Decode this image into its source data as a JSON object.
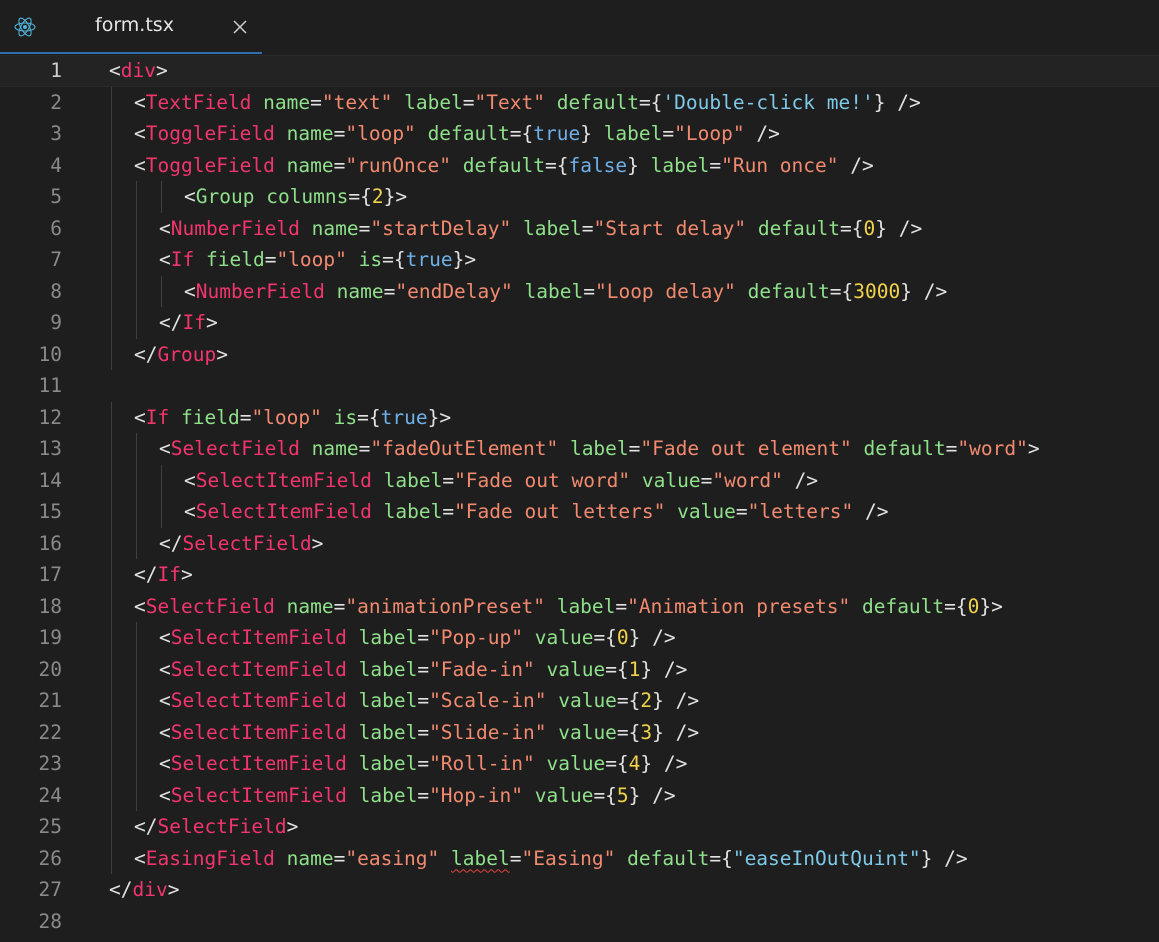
{
  "tab": {
    "icon": "react-icon",
    "title": "form.tsx",
    "close_icon": "close-icon"
  },
  "editor": {
    "current_line": 1,
    "lines": [
      {
        "n": "1",
        "indent": 0,
        "tokens": [
          [
            "p",
            "<"
          ],
          [
            "t",
            "div"
          ],
          [
            "p",
            ">"
          ]
        ]
      },
      {
        "n": "2",
        "indent": 1,
        "tokens": [
          [
            "p",
            "<"
          ],
          [
            "t",
            "TextField"
          ],
          [
            "p",
            " "
          ],
          [
            "a",
            "name"
          ],
          [
            "p",
            "="
          ],
          [
            "s",
            "\"text\""
          ],
          [
            "p",
            " "
          ],
          [
            "a",
            "label"
          ],
          [
            "p",
            "="
          ],
          [
            "s",
            "\"Text\""
          ],
          [
            "p",
            " "
          ],
          [
            "a",
            "default"
          ],
          [
            "p",
            "={"
          ],
          [
            "c",
            "'Double-click me!'"
          ],
          [
            "p",
            "} />"
          ]
        ]
      },
      {
        "n": "3",
        "indent": 1,
        "tokens": [
          [
            "p",
            "<"
          ],
          [
            "t",
            "ToggleField"
          ],
          [
            "p",
            " "
          ],
          [
            "a",
            "name"
          ],
          [
            "p",
            "="
          ],
          [
            "s",
            "\"loop\""
          ],
          [
            "p",
            " "
          ],
          [
            "a",
            "default"
          ],
          [
            "p",
            "={"
          ],
          [
            "k",
            "true"
          ],
          [
            "p",
            "} "
          ],
          [
            "a",
            "label"
          ],
          [
            "p",
            "="
          ],
          [
            "s",
            "\"Loop\""
          ],
          [
            "p",
            " />"
          ]
        ]
      },
      {
        "n": "4",
        "indent": 1,
        "tokens": [
          [
            "p",
            "<"
          ],
          [
            "t",
            "ToggleField"
          ],
          [
            "p",
            " "
          ],
          [
            "a",
            "name"
          ],
          [
            "p",
            "="
          ],
          [
            "s",
            "\"runOnce\""
          ],
          [
            "p",
            " "
          ],
          [
            "a",
            "default"
          ],
          [
            "p",
            "={"
          ],
          [
            "k",
            "false"
          ],
          [
            "p",
            "} "
          ],
          [
            "a",
            "label"
          ],
          [
            "p",
            "="
          ],
          [
            "s",
            "\"Run once\""
          ],
          [
            "p",
            " />"
          ]
        ]
      },
      {
        "n": "5",
        "indent": 3,
        "tokens": [
          [
            "p",
            "<"
          ],
          [
            "a",
            "Group"
          ],
          [
            "p",
            " "
          ],
          [
            "a",
            "columns"
          ],
          [
            "p",
            "={"
          ],
          [
            "n",
            "2"
          ],
          [
            "p",
            "}>"
          ]
        ]
      },
      {
        "n": "6",
        "indent": 2,
        "tokens": [
          [
            "p",
            "<"
          ],
          [
            "t",
            "NumberField"
          ],
          [
            "p",
            " "
          ],
          [
            "a",
            "name"
          ],
          [
            "p",
            "="
          ],
          [
            "s",
            "\"startDelay\""
          ],
          [
            "p",
            " "
          ],
          [
            "a",
            "label"
          ],
          [
            "p",
            "="
          ],
          [
            "s",
            "\"Start delay\""
          ],
          [
            "p",
            " "
          ],
          [
            "a",
            "default"
          ],
          [
            "p",
            "={"
          ],
          [
            "n",
            "0"
          ],
          [
            "p",
            "} />"
          ]
        ]
      },
      {
        "n": "7",
        "indent": 2,
        "tokens": [
          [
            "p",
            "<"
          ],
          [
            "t",
            "If"
          ],
          [
            "p",
            " "
          ],
          [
            "a",
            "field"
          ],
          [
            "p",
            "="
          ],
          [
            "s",
            "\"loop\""
          ],
          [
            "p",
            " "
          ],
          [
            "a",
            "is"
          ],
          [
            "p",
            "={"
          ],
          [
            "k",
            "true"
          ],
          [
            "p",
            "}>"
          ]
        ]
      },
      {
        "n": "8",
        "indent": 3,
        "tokens": [
          [
            "p",
            "<"
          ],
          [
            "t",
            "NumberField"
          ],
          [
            "p",
            " "
          ],
          [
            "a",
            "name"
          ],
          [
            "p",
            "="
          ],
          [
            "s",
            "\"endDelay\""
          ],
          [
            "p",
            " "
          ],
          [
            "a",
            "label"
          ],
          [
            "p",
            "="
          ],
          [
            "s",
            "\"Loop delay\""
          ],
          [
            "p",
            " "
          ],
          [
            "a",
            "default"
          ],
          [
            "p",
            "={"
          ],
          [
            "n",
            "3000"
          ],
          [
            "p",
            "} />"
          ]
        ]
      },
      {
        "n": "9",
        "indent": 2,
        "tokens": [
          [
            "p",
            "</"
          ],
          [
            "t",
            "If"
          ],
          [
            "p",
            ">"
          ]
        ]
      },
      {
        "n": "10",
        "indent": 1,
        "tokens": [
          [
            "p",
            "</"
          ],
          [
            "t",
            "Group"
          ],
          [
            "p",
            ">"
          ]
        ]
      },
      {
        "n": "11",
        "indent": 0,
        "tokens": []
      },
      {
        "n": "12",
        "indent": 1,
        "tokens": [
          [
            "p",
            "<"
          ],
          [
            "t",
            "If"
          ],
          [
            "p",
            " "
          ],
          [
            "a",
            "field"
          ],
          [
            "p",
            "="
          ],
          [
            "s",
            "\"loop\""
          ],
          [
            "p",
            " "
          ],
          [
            "a",
            "is"
          ],
          [
            "p",
            "={"
          ],
          [
            "k",
            "true"
          ],
          [
            "p",
            "}>"
          ]
        ]
      },
      {
        "n": "13",
        "indent": 2,
        "tokens": [
          [
            "p",
            "<"
          ],
          [
            "t",
            "SelectField"
          ],
          [
            "p",
            " "
          ],
          [
            "a",
            "name"
          ],
          [
            "p",
            "="
          ],
          [
            "s",
            "\"fadeOutElement\""
          ],
          [
            "p",
            " "
          ],
          [
            "a",
            "label"
          ],
          [
            "p",
            "="
          ],
          [
            "s",
            "\"Fade out element\""
          ],
          [
            "p",
            " "
          ],
          [
            "a",
            "default"
          ],
          [
            "p",
            "="
          ],
          [
            "s",
            "\"word\""
          ],
          [
            "p",
            ">"
          ]
        ]
      },
      {
        "n": "14",
        "indent": 3,
        "tokens": [
          [
            "p",
            "<"
          ],
          [
            "t",
            "SelectItemField"
          ],
          [
            "p",
            " "
          ],
          [
            "a",
            "label"
          ],
          [
            "p",
            "="
          ],
          [
            "s",
            "\"Fade out word\""
          ],
          [
            "p",
            " "
          ],
          [
            "a",
            "value"
          ],
          [
            "p",
            "="
          ],
          [
            "s",
            "\"word\""
          ],
          [
            "p",
            " />"
          ]
        ]
      },
      {
        "n": "15",
        "indent": 3,
        "tokens": [
          [
            "p",
            "<"
          ],
          [
            "t",
            "SelectItemField"
          ],
          [
            "p",
            " "
          ],
          [
            "a",
            "label"
          ],
          [
            "p",
            "="
          ],
          [
            "s",
            "\"Fade out letters\""
          ],
          [
            "p",
            " "
          ],
          [
            "a",
            "value"
          ],
          [
            "p",
            "="
          ],
          [
            "s",
            "\"letters\""
          ],
          [
            "p",
            " />"
          ]
        ]
      },
      {
        "n": "16",
        "indent": 2,
        "tokens": [
          [
            "p",
            "</"
          ],
          [
            "t",
            "SelectField"
          ],
          [
            "p",
            ">"
          ]
        ]
      },
      {
        "n": "17",
        "indent": 1,
        "tokens": [
          [
            "p",
            "</"
          ],
          [
            "t",
            "If"
          ],
          [
            "p",
            ">"
          ]
        ]
      },
      {
        "n": "18",
        "indent": 1,
        "tokens": [
          [
            "p",
            "<"
          ],
          [
            "t",
            "SelectField"
          ],
          [
            "p",
            " "
          ],
          [
            "a",
            "name"
          ],
          [
            "p",
            "="
          ],
          [
            "s",
            "\"animationPreset\""
          ],
          [
            "p",
            " "
          ],
          [
            "a",
            "label"
          ],
          [
            "p",
            "="
          ],
          [
            "s",
            "\"Animation presets\""
          ],
          [
            "p",
            " "
          ],
          [
            "a",
            "default"
          ],
          [
            "p",
            "={"
          ],
          [
            "n",
            "0"
          ],
          [
            "p",
            "}>"
          ]
        ]
      },
      {
        "n": "19",
        "indent": 2,
        "tokens": [
          [
            "p",
            "<"
          ],
          [
            "t",
            "SelectItemField"
          ],
          [
            "p",
            " "
          ],
          [
            "a",
            "label"
          ],
          [
            "p",
            "="
          ],
          [
            "s",
            "\"Pop-up\""
          ],
          [
            "p",
            " "
          ],
          [
            "a",
            "value"
          ],
          [
            "p",
            "={"
          ],
          [
            "n",
            "0"
          ],
          [
            "p",
            "} />"
          ]
        ]
      },
      {
        "n": "20",
        "indent": 2,
        "tokens": [
          [
            "p",
            "<"
          ],
          [
            "t",
            "SelectItemField"
          ],
          [
            "p",
            " "
          ],
          [
            "a",
            "label"
          ],
          [
            "p",
            "="
          ],
          [
            "s",
            "\"Fade-in\""
          ],
          [
            "p",
            " "
          ],
          [
            "a",
            "value"
          ],
          [
            "p",
            "={"
          ],
          [
            "n",
            "1"
          ],
          [
            "p",
            "} />"
          ]
        ]
      },
      {
        "n": "21",
        "indent": 2,
        "tokens": [
          [
            "p",
            "<"
          ],
          [
            "t",
            "SelectItemField"
          ],
          [
            "p",
            " "
          ],
          [
            "a",
            "label"
          ],
          [
            "p",
            "="
          ],
          [
            "s",
            "\"Scale-in\""
          ],
          [
            "p",
            " "
          ],
          [
            "a",
            "value"
          ],
          [
            "p",
            "={"
          ],
          [
            "n",
            "2"
          ],
          [
            "p",
            "} />"
          ]
        ]
      },
      {
        "n": "22",
        "indent": 2,
        "tokens": [
          [
            "p",
            "<"
          ],
          [
            "t",
            "SelectItemField"
          ],
          [
            "p",
            " "
          ],
          [
            "a",
            "label"
          ],
          [
            "p",
            "="
          ],
          [
            "s",
            "\"Slide-in\""
          ],
          [
            "p",
            " "
          ],
          [
            "a",
            "value"
          ],
          [
            "p",
            "={"
          ],
          [
            "n",
            "3"
          ],
          [
            "p",
            "} />"
          ]
        ]
      },
      {
        "n": "23",
        "indent": 2,
        "tokens": [
          [
            "p",
            "<"
          ],
          [
            "t",
            "SelectItemField"
          ],
          [
            "p",
            " "
          ],
          [
            "a",
            "label"
          ],
          [
            "p",
            "="
          ],
          [
            "s",
            "\"Roll-in\""
          ],
          [
            "p",
            " "
          ],
          [
            "a",
            "value"
          ],
          [
            "p",
            "={"
          ],
          [
            "n",
            "4"
          ],
          [
            "p",
            "} />"
          ]
        ]
      },
      {
        "n": "24",
        "indent": 2,
        "tokens": [
          [
            "p",
            "<"
          ],
          [
            "t",
            "SelectItemField"
          ],
          [
            "p",
            " "
          ],
          [
            "a",
            "label"
          ],
          [
            "p",
            "="
          ],
          [
            "s",
            "\"Hop-in\""
          ],
          [
            "p",
            " "
          ],
          [
            "a",
            "value"
          ],
          [
            "p",
            "={"
          ],
          [
            "n",
            "5"
          ],
          [
            "p",
            "} />"
          ]
        ]
      },
      {
        "n": "25",
        "indent": 1,
        "tokens": [
          [
            "p",
            "</"
          ],
          [
            "t",
            "SelectField"
          ],
          [
            "p",
            ">"
          ]
        ]
      },
      {
        "n": "26",
        "indent": 1,
        "tokens": [
          [
            "p",
            "<"
          ],
          [
            "t",
            "EasingField"
          ],
          [
            "p",
            " "
          ],
          [
            "a",
            "name"
          ],
          [
            "p",
            "="
          ],
          [
            "s",
            "\"easing\""
          ],
          [
            "p",
            " "
          ],
          [
            "a",
            "label",
            "squig"
          ],
          [
            "p",
            "="
          ],
          [
            "s",
            "\"Easing\""
          ],
          [
            "p",
            " "
          ],
          [
            "a",
            "default"
          ],
          [
            "p",
            "={"
          ],
          [
            "c",
            "\"easeInOutQuint\""
          ],
          [
            "p",
            "} />"
          ]
        ]
      },
      {
        "n": "27",
        "indent": 0,
        "tokens": [
          [
            "p",
            "</"
          ],
          [
            "t",
            "div"
          ],
          [
            "p",
            ">"
          ]
        ]
      },
      {
        "n": "28",
        "indent": 0,
        "tokens": []
      }
    ]
  }
}
